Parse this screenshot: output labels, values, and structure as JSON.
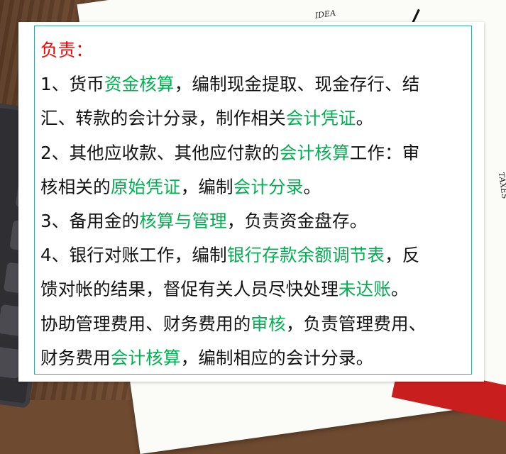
{
  "card": {
    "title": "负责：",
    "lines": [
      [
        {
          "t": "1、货币"
        },
        {
          "t": "资金核算",
          "hl": true
        },
        {
          "t": "，编制现金提取、现金存行、结"
        }
      ],
      [
        {
          "t": "汇、转款的会计分录，制作相关"
        },
        {
          "t": "会计凭证",
          "hl": true
        },
        {
          "t": "。"
        }
      ],
      [
        {
          "t": "2、其他应收款、其他应付款的"
        },
        {
          "t": "会计核算",
          "hl": true
        },
        {
          "t": "工作：审"
        }
      ],
      [
        {
          "t": "核相关的"
        },
        {
          "t": "原始凭证",
          "hl": true
        },
        {
          "t": "，编制"
        },
        {
          "t": "会计分录",
          "hl": true
        },
        {
          "t": "。"
        }
      ],
      [
        {
          "t": "3、备用金的"
        },
        {
          "t": "核算与管理",
          "hl": true
        },
        {
          "t": "，负责资金盘存。"
        }
      ],
      [
        {
          "t": "4、银行对账工作，编制"
        },
        {
          "t": "银行存款余额调节表",
          "hl": true
        },
        {
          "t": "，反"
        }
      ],
      [
        {
          "t": "馈对帐的结果，督促有关人员尽快处理"
        },
        {
          "t": "未达账",
          "hl": true
        },
        {
          "t": "。"
        }
      ],
      [
        {
          "t": "协助管理费用、财务费用的"
        },
        {
          "t": "审核",
          "hl": true
        },
        {
          "t": "，负责管理费用、"
        }
      ],
      [
        {
          "t": "财务费用"
        },
        {
          "t": "会计核算",
          "hl": true
        },
        {
          "t": "，编制相应的会计分录。"
        }
      ]
    ]
  },
  "background": {
    "paper_scribble_top": "IDEA",
    "paper_scribble_side": "TAXES"
  },
  "colors": {
    "title": "#ff0000",
    "highlight": "#00b050",
    "text": "#111111",
    "frame": "#3aa6a0"
  }
}
